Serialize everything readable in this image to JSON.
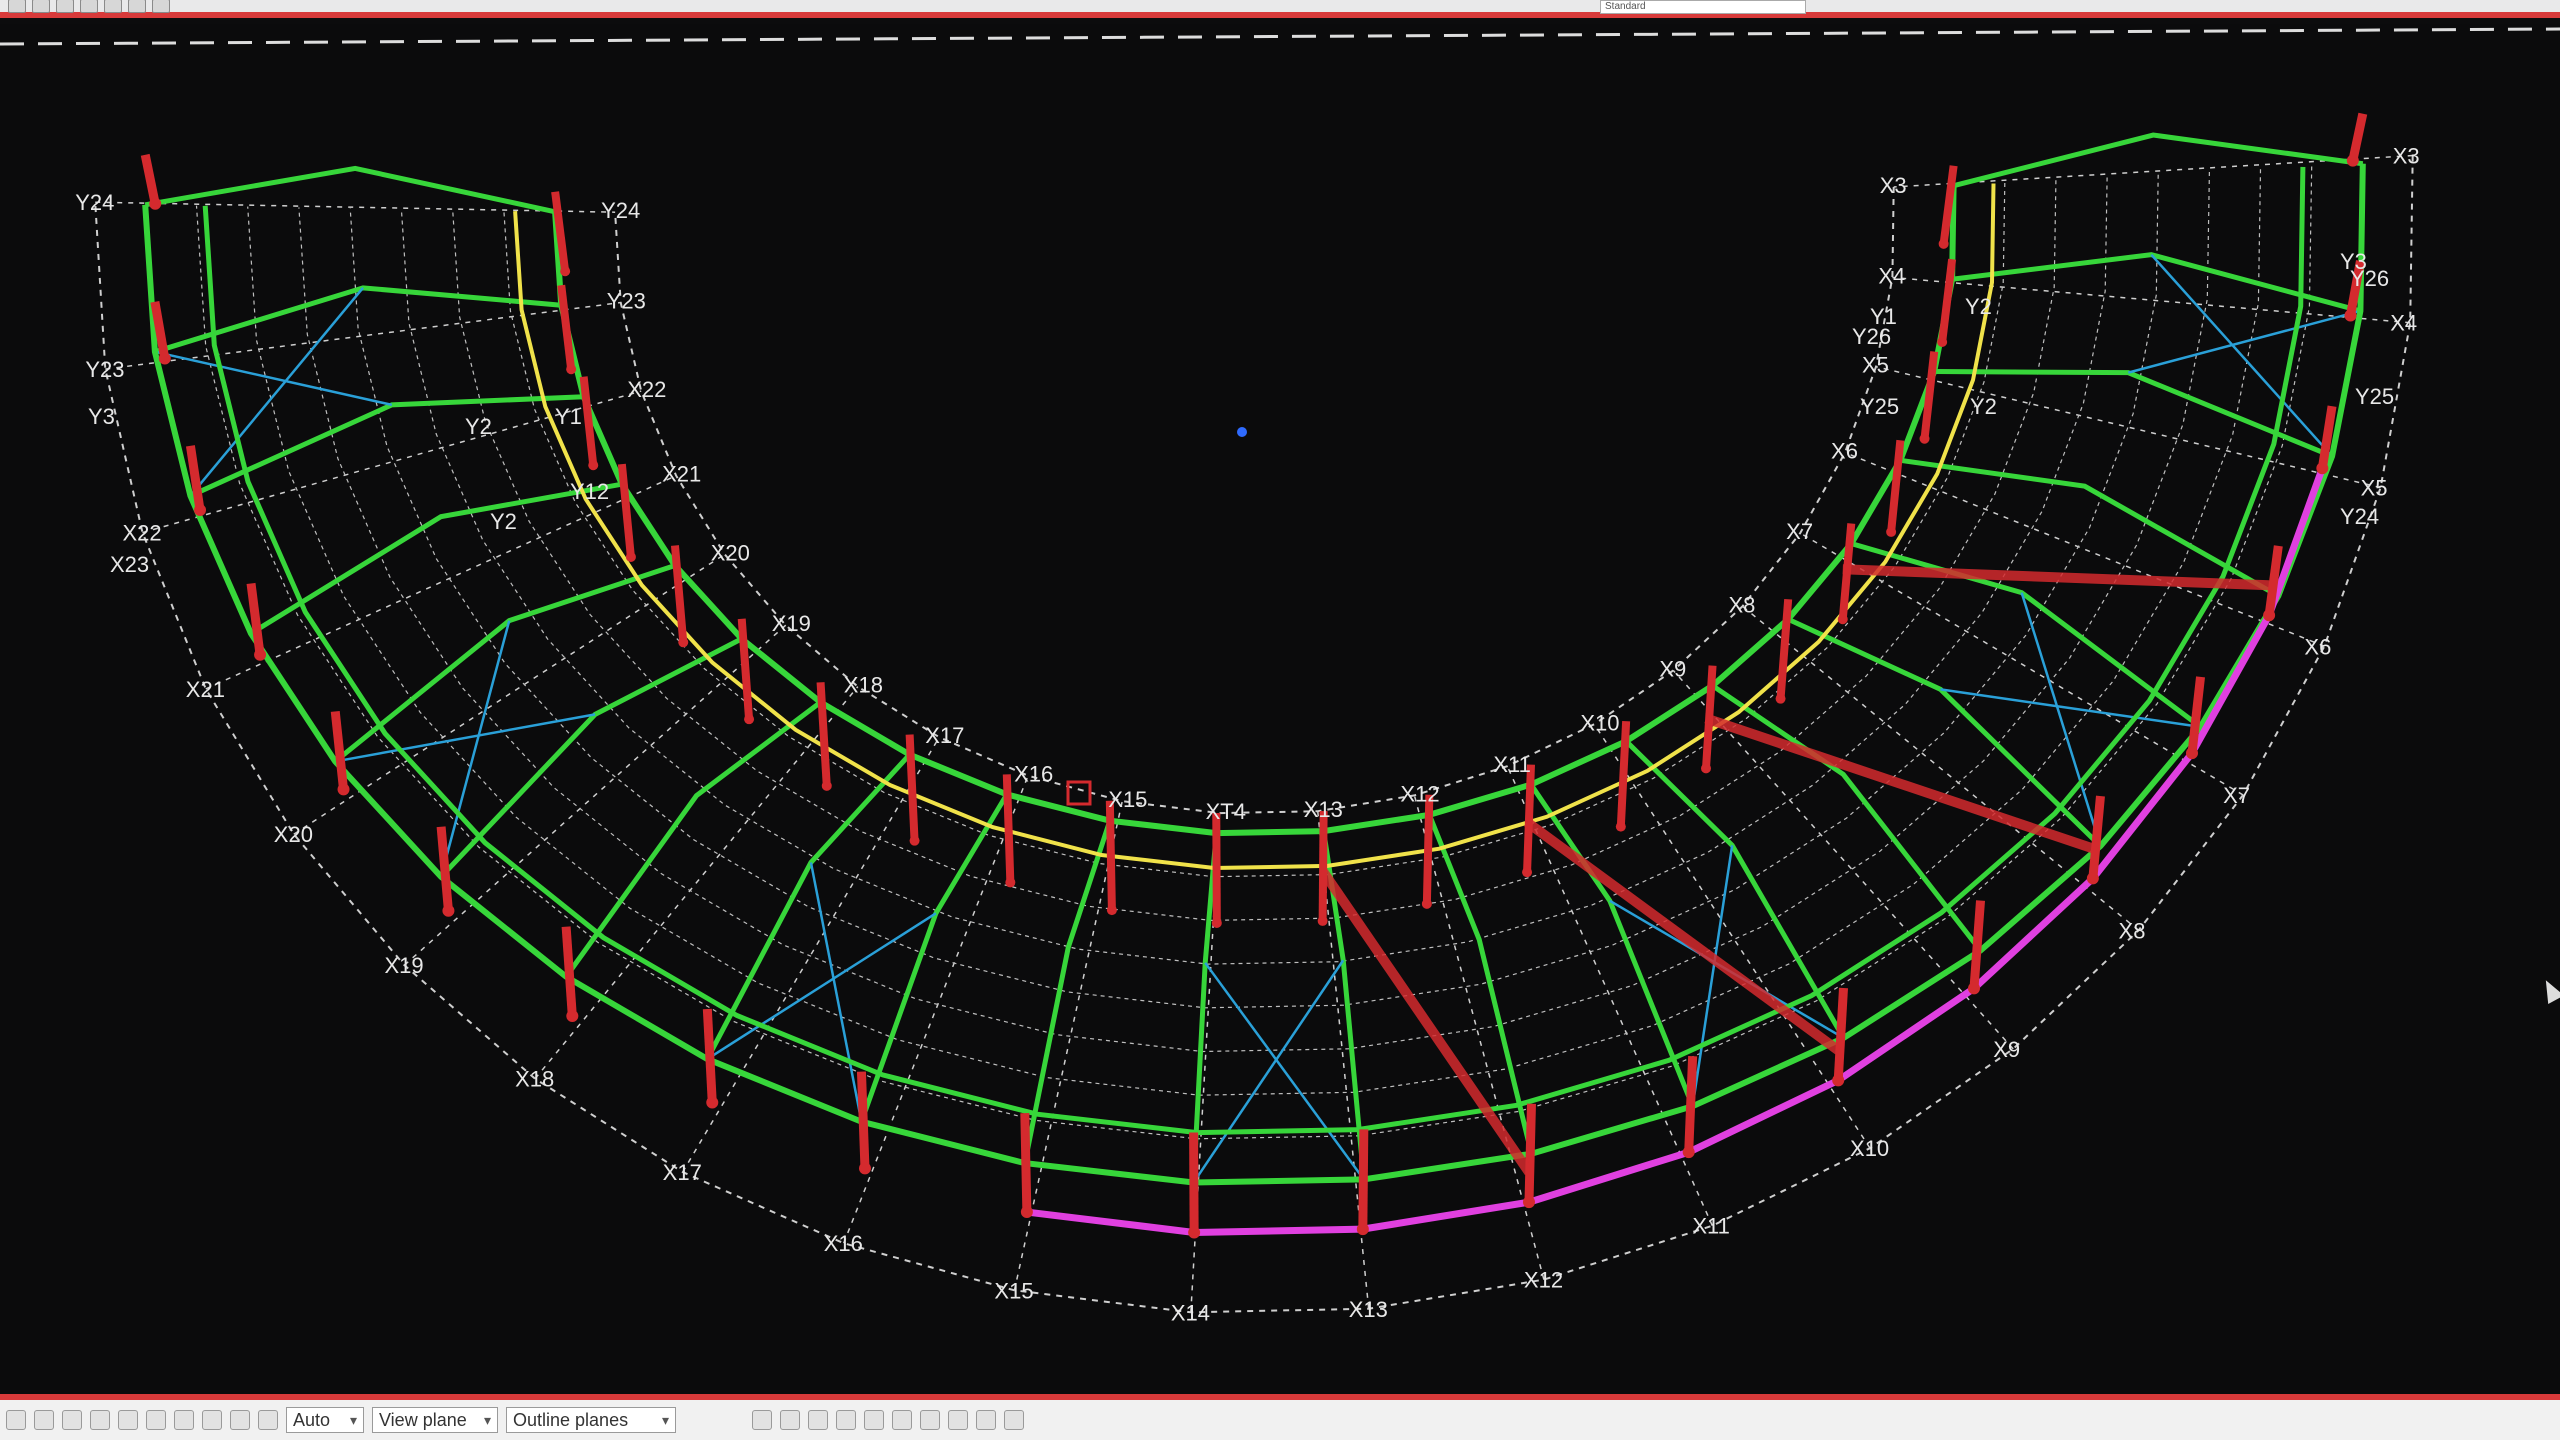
{
  "toolbar": {
    "field_value": "Standard"
  },
  "bottom_toolbar": {
    "selects": [
      {
        "value": "Auto"
      },
      {
        "value": "View plane"
      },
      {
        "value": "Outline planes"
      }
    ]
  },
  "grid_labels": {
    "outer_x": [
      "X3",
      "X4",
      "X5",
      "X6",
      "X7",
      "X8",
      "X9",
      "X10",
      "X11",
      "X12",
      "X13",
      "X14",
      "X15",
      "X16",
      "X17",
      "X18",
      "X19",
      "X20",
      "X21",
      "X22",
      "Y23",
      "Y24"
    ],
    "inner_x": [
      "X3",
      "X4",
      "X5",
      "X6",
      "X7",
      "X8",
      "X9",
      "X10",
      "X11",
      "X12",
      "X13",
      "XT4",
      "X15",
      "X16",
      "X17",
      "X18",
      "X19",
      "X20",
      "X21",
      "X22",
      "Y23",
      "Y24"
    ],
    "y_left": [
      "Y3",
      "Y2",
      "Y1",
      "Y12",
      "Y2",
      "X23"
    ],
    "y_right": [
      "Y3",
      "Y26",
      "Y1",
      "Y2",
      "Y26",
      "Y25",
      "Y2",
      "Y25",
      "Y24"
    ]
  },
  "colors": {
    "background": "#0b0b0c",
    "beam": "#37d63a",
    "column": "#d42a2e",
    "brace": "#2aa0d8",
    "purlin": "#f0e24a",
    "edge": "#e040e0",
    "grid": "#cfcfcf",
    "frame_accent": "#d83a3a"
  }
}
